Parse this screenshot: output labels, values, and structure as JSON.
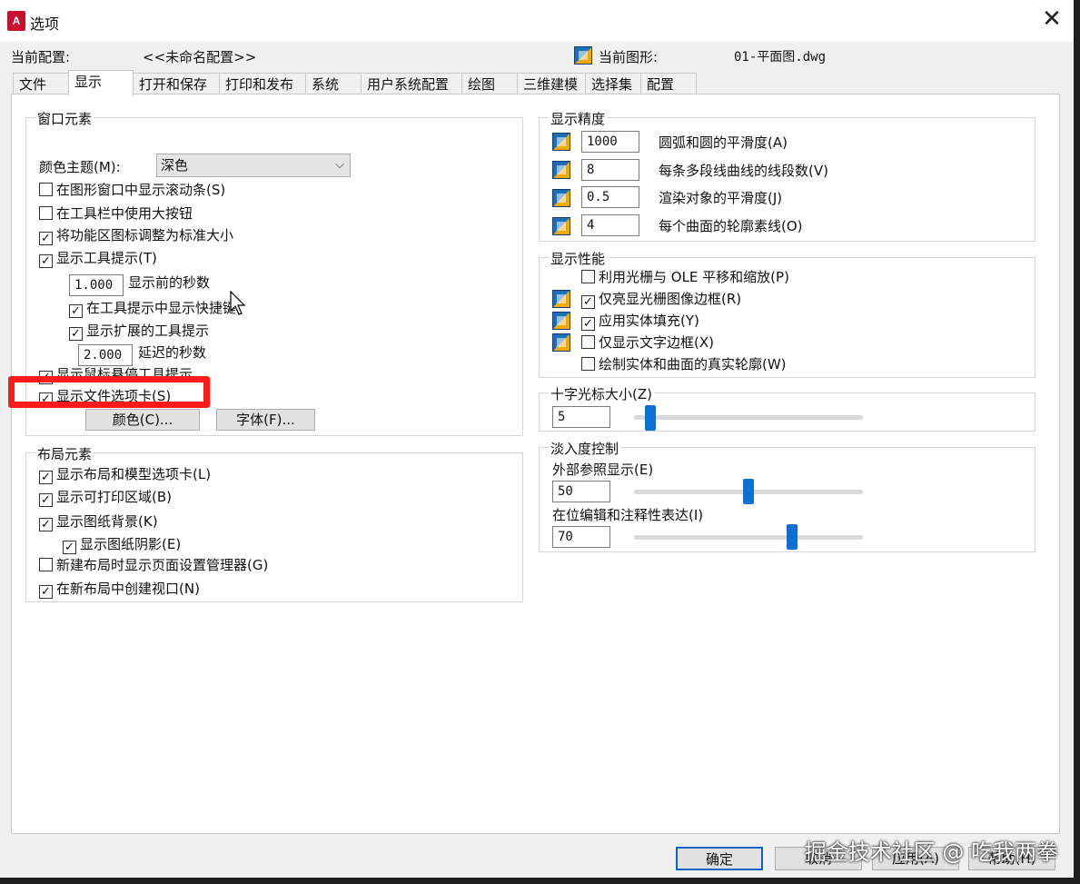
{
  "window": {
    "title": "选项",
    "close_glyph": "✕"
  },
  "header": {
    "current_profile_label": "当前配置:",
    "current_profile_value": "<<未命名配置>>",
    "current_drawing_label": "当前图形:",
    "current_drawing_value": "01-平面图.dwg"
  },
  "tabs": [
    "文件",
    "显示",
    "打开和保存",
    "打印和发布",
    "系统",
    "用户系统配置",
    "绘图",
    "三维建模",
    "选择集",
    "配置"
  ],
  "active_tab": "显示",
  "window_elements": {
    "title": "窗口元素",
    "color_theme_label": "颜色主题(M):",
    "color_theme_value": "深色",
    "checkboxes": [
      {
        "label": "在图形窗口中显示滚动条(S)",
        "checked": false
      },
      {
        "label": "在工具栏中使用大按钮",
        "checked": false
      },
      {
        "label": "将功能区图标调整为标准大小",
        "checked": true
      },
      {
        "label": "显示工具提示(T)",
        "checked": true
      },
      {
        "label": "在工具提示中显示快捷键",
        "checked": true
      },
      {
        "label": "显示扩展的工具提示",
        "checked": true
      },
      {
        "label": "显示鼠标悬停工具提示",
        "checked": true
      },
      {
        "label": "显示文件选项卡(S)",
        "checked": true
      }
    ],
    "tooltip_delay_value": "1.000",
    "tooltip_delay_label": "显示前的秒数",
    "ext_delay_value": "2.000",
    "ext_delay_label": "延迟的秒数",
    "colors_button": "颜色(C)...",
    "fonts_button": "字体(F)..."
  },
  "layout_elements": {
    "title": "布局元素",
    "checkboxes": [
      {
        "label": "显示布局和模型选项卡(L)",
        "checked": true
      },
      {
        "label": "显示可打印区域(B)",
        "checked": true
      },
      {
        "label": "显示图纸背景(K)",
        "checked": true
      },
      {
        "label": "显示图纸阴影(E)",
        "checked": true
      },
      {
        "label": "新建布局时显示页面设置管理器(G)",
        "checked": false
      },
      {
        "label": "在新布局中创建视口(N)",
        "checked": true
      }
    ]
  },
  "display_resolution": {
    "title": "显示精度",
    "rows": [
      {
        "value": "1000",
        "label": "圆弧和圆的平滑度(A)"
      },
      {
        "value": "8",
        "label": "每条多段线曲线的线段数(V)"
      },
      {
        "value": "0.5",
        "label": "渲染对象的平滑度(J)"
      },
      {
        "value": "4",
        "label": "每个曲面的轮廓素线(O)"
      }
    ]
  },
  "display_performance": {
    "title": "显示性能",
    "checkboxes": [
      {
        "label": "利用光栅与 OLE 平移和缩放(P)",
        "checked": false
      },
      {
        "label": "仅亮显光栅图像边框(R)",
        "checked": true
      },
      {
        "label": "应用实体填充(Y)",
        "checked": true
      },
      {
        "label": "仅显示文字边框(X)",
        "checked": false
      },
      {
        "label": "绘制实体和曲面的真实轮廓(W)",
        "checked": false
      }
    ]
  },
  "crosshair": {
    "title": "十字光标大小(Z)",
    "value": "5",
    "slider_fraction": 0.05
  },
  "fade_control": {
    "title": "淡入度控制",
    "xref_label": "外部参照显示(E)",
    "xref_value": "50",
    "xref_fraction": 0.5,
    "inplace_label": "在位编辑和注释性表达(I)",
    "inplace_value": "70",
    "inplace_fraction": 0.7
  },
  "buttons": {
    "ok": "确定",
    "cancel": "取消",
    "apply": "应用(A)",
    "help": "帮助(H)"
  },
  "watermark": "掘金技术社区 @ 吃我两拳",
  "colors": {
    "highlight": "#ff1a1a",
    "slider": "#0a70d6",
    "accent": "#0a64cc"
  },
  "icons": [
    "autocad-app-icon",
    "drawing-file-icon",
    "setting-saved-in-drawing-icon",
    "mouse-cursor-icon"
  ]
}
